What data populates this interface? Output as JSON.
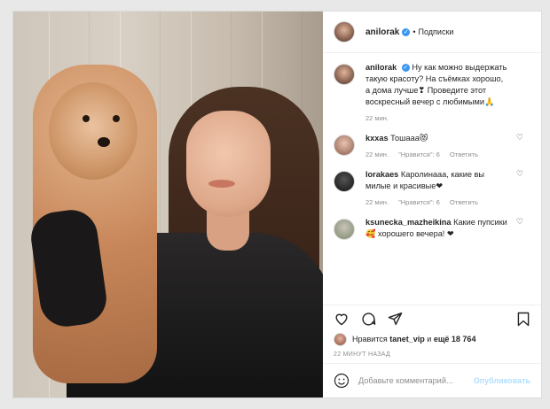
{
  "header": {
    "username": "anilorak",
    "dot": "•",
    "follow_label": "Подписки"
  },
  "caption": {
    "username": "anilorak",
    "text": "Ну как можно выдержать такую красоту? На съёмках хорошо, а дома лучше❣ Проведите этот воскресный вечер с любимыми🙏",
    "time": "22 мин."
  },
  "comments": [
    {
      "username": "kxxas",
      "text": "Тошааа😻",
      "time": "22 мин.",
      "likes": "\"Нравится\": 6",
      "reply": "Ответить"
    },
    {
      "username": "lorakaes",
      "text": "Каролинааа, какие вы милые и красивые❤",
      "time": "22 мин.",
      "likes": "\"Нравится\": 6",
      "reply": "Ответить"
    },
    {
      "username": "ksunecka_mazheikina",
      "text": "Какие пупсики 🥰 хорошего вечера! ❤",
      "time": "",
      "likes": "",
      "reply": ""
    }
  ],
  "likes": {
    "prefix": "Нравится",
    "user": "tanet_vip",
    "middle": "и",
    "count": "ещё 18 764"
  },
  "timestamp": "22 МИНУТ НАЗАД",
  "add_comment": {
    "placeholder": "Добавьте комментарий...",
    "publish_label": "Опубликовать"
  },
  "colors": {
    "verified": "#3897f0",
    "publish": "#b2dffc",
    "meta": "#8e8e8e"
  }
}
